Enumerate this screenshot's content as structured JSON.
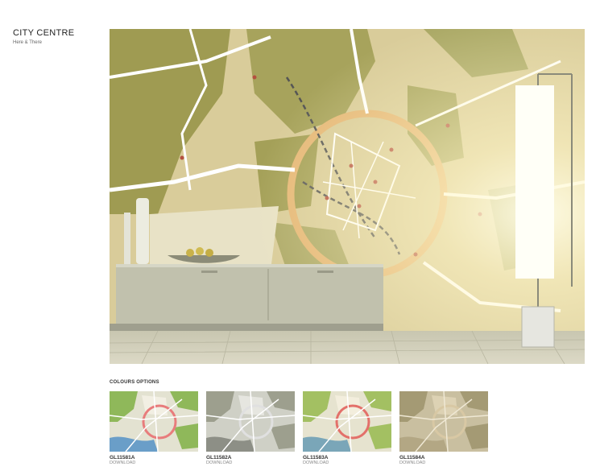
{
  "page": {
    "title": "CITY CENTRE",
    "subtitle": "Here & There"
  },
  "hero": {
    "map_bg": "#d9cc9a",
    "park_color": "#9f9b52",
    "road_color": "#ffffff",
    "ring_road_color": "#e5b777",
    "furniture_color": "#c1c1ad",
    "floor_color": "#d2cfb9",
    "lamp_color": "#fffff7"
  },
  "colour_options": {
    "heading": "COLOURS OPTIONS",
    "options": [
      {
        "code": "GL11581A",
        "link": "DOWNLOAD",
        "bg": "#e3e2d1",
        "park": "#8fb85a",
        "road": "#ffffff",
        "ring": "#e87c7c",
        "water": "#6a9ec8",
        "land": "#f2efe3"
      },
      {
        "code": "GL11582A",
        "link": "DOWNLOAD",
        "bg": "#cfd0c6",
        "park": "#9d9f8e",
        "road": "#ffffff",
        "ring": "#e0e0e0",
        "water": "#8d8f86",
        "land": "#e6e6e0"
      },
      {
        "code": "GL11583A",
        "link": "DOWNLOAD",
        "bg": "#e6e3cf",
        "park": "#a3c062",
        "road": "#ffffff",
        "ring": "#e3706a",
        "water": "#7aa6b8",
        "land": "#f3eedd"
      },
      {
        "code": "GL11584A",
        "link": "DOWNLOAD",
        "bg": "#c9bfa0",
        "park": "#a49a74",
        "road": "#efe8d4",
        "ring": "#d8c8a4",
        "water": "#b3a784",
        "land": "#ddd2b4"
      }
    ]
  }
}
